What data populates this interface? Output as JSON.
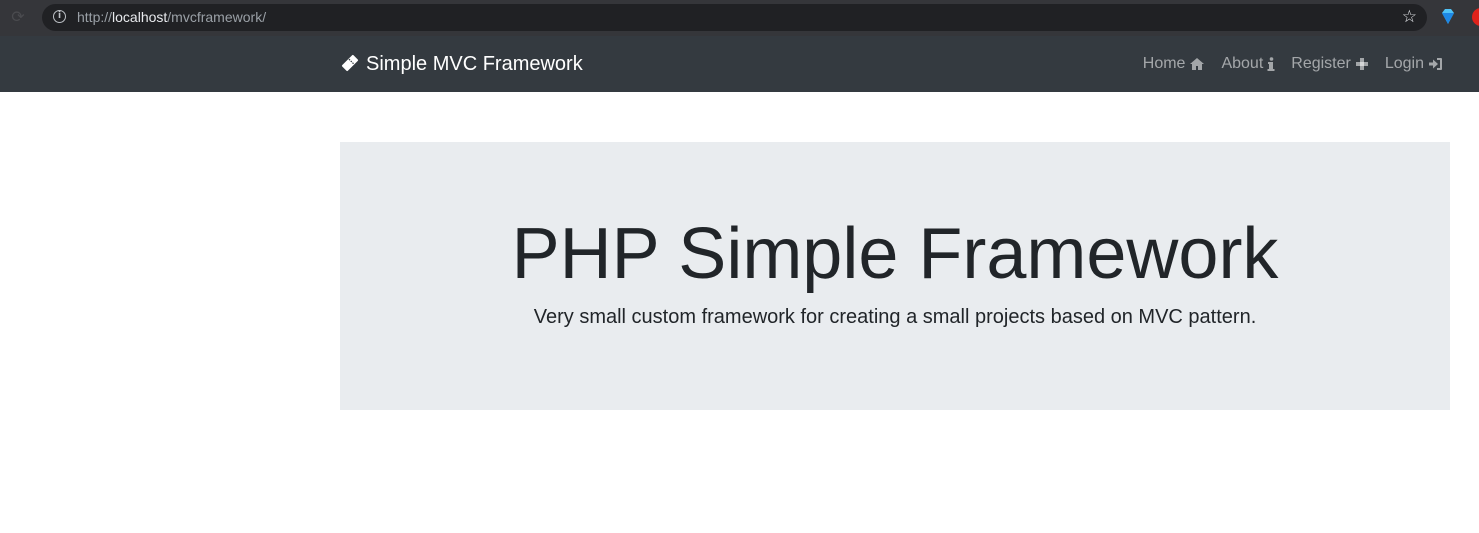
{
  "browser": {
    "url_scheme": "http://",
    "url_host": "localhost",
    "url_path": "/mvcframework/",
    "reload_icon": "reload-icon",
    "info_icon": "info-icon",
    "bookmark_icon": "star-icon"
  },
  "navbar": {
    "brand": "Simple MVC Framework",
    "brand_icon": "ticket-icon",
    "links": [
      {
        "label": "Home",
        "icon": "home-icon"
      },
      {
        "label": "About",
        "icon": "info-icon"
      },
      {
        "label": "Register",
        "icon": "plus-icon"
      },
      {
        "label": "Login",
        "icon": "sign-in-icon"
      }
    ],
    "background": "#343a40"
  },
  "jumbotron": {
    "title": "PHP Simple Framework",
    "lead": "Very small custom framework for creating a small projects based on MVC pattern.",
    "background": "#e9ecef"
  }
}
